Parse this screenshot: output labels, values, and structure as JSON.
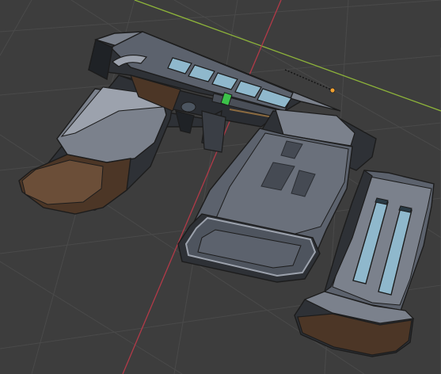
{
  "viewport": {
    "background": "#3d3d3d",
    "grid_color": "#4a4a4a",
    "x_axis_color": "#b23a48",
    "y_axis_color": "#8db33a",
    "origin_color": "#f0a030"
  },
  "model": {
    "outline": "#1c1c1c",
    "body_dark": "#2e3136",
    "body_mid": "#545a64",
    "body_light": "#7b818c",
    "body_highlight": "#9ca2ad",
    "grip_wood": "#4c3626",
    "grip_wood_light": "#6b4e38",
    "window_blue": "#8fb8cc",
    "window_dark": "#2a3a44",
    "green_indicator": "#3cc24a"
  }
}
